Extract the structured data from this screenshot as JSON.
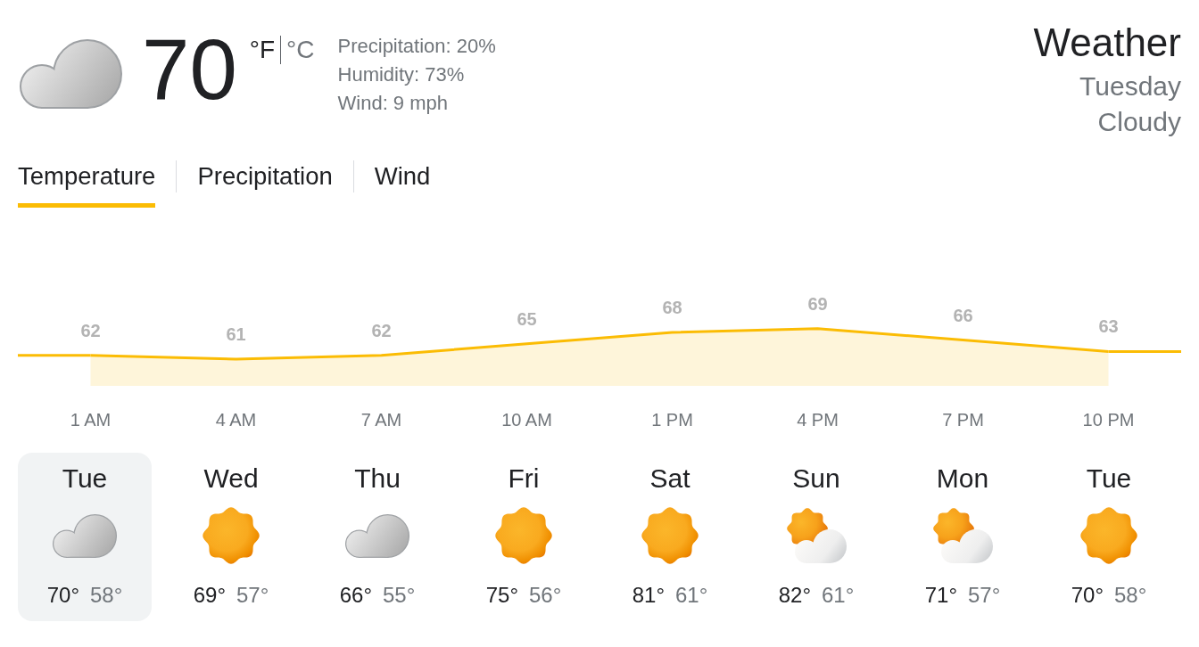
{
  "current": {
    "kind": "cloudy",
    "temperature": "70",
    "units": [
      {
        "label": "°F",
        "selected": true
      },
      {
        "label": "°C",
        "selected": false
      }
    ],
    "details": [
      "Precipitation: 20%",
      "Humidity: 73%",
      "Wind: 9 mph"
    ]
  },
  "header": {
    "title": "Weather",
    "day": "Tuesday",
    "condition": "Cloudy"
  },
  "tabs": [
    {
      "label": "Temperature",
      "selected": true
    },
    {
      "label": "Precipitation",
      "selected": false
    },
    {
      "label": "Wind",
      "selected": false
    }
  ],
  "hourly": {
    "chart_data": {
      "type": "area",
      "categories": [
        "1 AM",
        "4 AM",
        "7 AM",
        "10 AM",
        "1 PM",
        "4 PM",
        "7 PM",
        "10 PM"
      ],
      "series": [
        {
          "color": "#fbbc04",
          "values": [
            62,
            61,
            62,
            65,
            68,
            69,
            66,
            63
          ]
        }
      ],
      "data_labels": true
    }
  },
  "days": [
    {
      "name": "Tue",
      "kind": "cloudy",
      "high": "70°",
      "low": "58°",
      "selected": true
    },
    {
      "name": "Wed",
      "kind": "sunny",
      "high": "69°",
      "low": "57°",
      "selected": false
    },
    {
      "name": "Thu",
      "kind": "cloudy",
      "high": "66°",
      "low": "55°",
      "selected": false
    },
    {
      "name": "Fri",
      "kind": "sunny",
      "high": "75°",
      "low": "56°",
      "selected": false
    },
    {
      "name": "Sat",
      "kind": "sunny",
      "high": "81°",
      "low": "61°",
      "selected": false
    },
    {
      "name": "Sun",
      "kind": "partly-cloudy",
      "high": "82°",
      "low": "61°",
      "selected": false
    },
    {
      "name": "Mon",
      "kind": "partly-cloudy",
      "high": "71°",
      "low": "57°",
      "selected": false
    },
    {
      "name": "Tue",
      "kind": "sunny",
      "high": "70°",
      "low": "58°",
      "selected": false
    }
  ]
}
